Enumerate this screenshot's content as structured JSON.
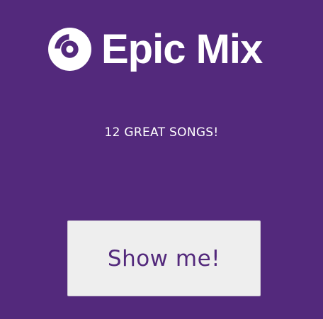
{
  "header": {
    "logo_icon": "disc-icon",
    "title": "Epic Mix"
  },
  "tagline": "12 GREAT SONGS!",
  "cta": {
    "label": "Show me!"
  },
  "colors": {
    "background": "#53297c",
    "button_background": "#eeeeee",
    "button_text": "#53297c",
    "text": "#ffffff"
  }
}
